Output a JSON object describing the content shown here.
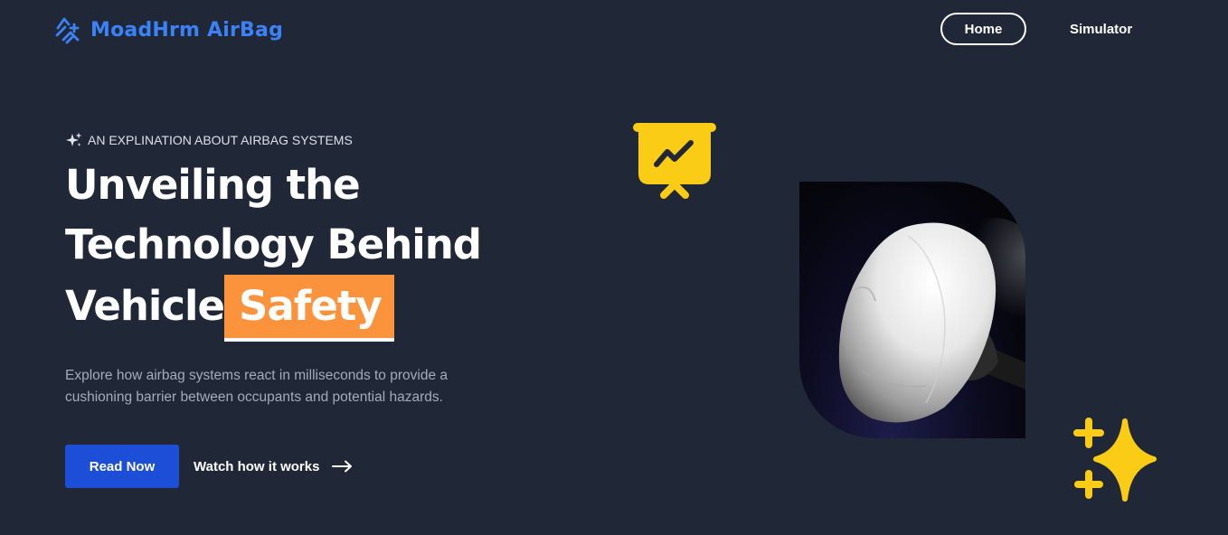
{
  "brand": {
    "name": "MoadHrm AirBag",
    "icon": "airbag-logo-icon",
    "color": "#3b82f6"
  },
  "nav": {
    "items": [
      {
        "label": "Home",
        "active": true
      },
      {
        "label": "Simulator",
        "active": false
      }
    ]
  },
  "hero": {
    "eyebrow": "AN EXPLINATION ABOUT AIRBAG SYSTEMS",
    "eyebrow_icon": "sparkle-icon",
    "title_line1": "Unveiling the",
    "title_line2": "Technology Behind",
    "title_line3_plain": "Vehicle",
    "title_line3_highlight": "Safety",
    "highlight_color": "#fb923c",
    "description": "Explore how airbag systems react in milliseconds to provide a cushioning barrier between occupants and potential hazards.",
    "primary_button": "Read Now",
    "secondary_button": "Watch how it works",
    "secondary_icon": "arrow-right-icon",
    "image": "deployed-airbag-image",
    "decorations": [
      "presentation-chart-icon",
      "sparkles-icon"
    ],
    "accent_color": "#facc15",
    "primary_color": "#1d4ed8"
  }
}
